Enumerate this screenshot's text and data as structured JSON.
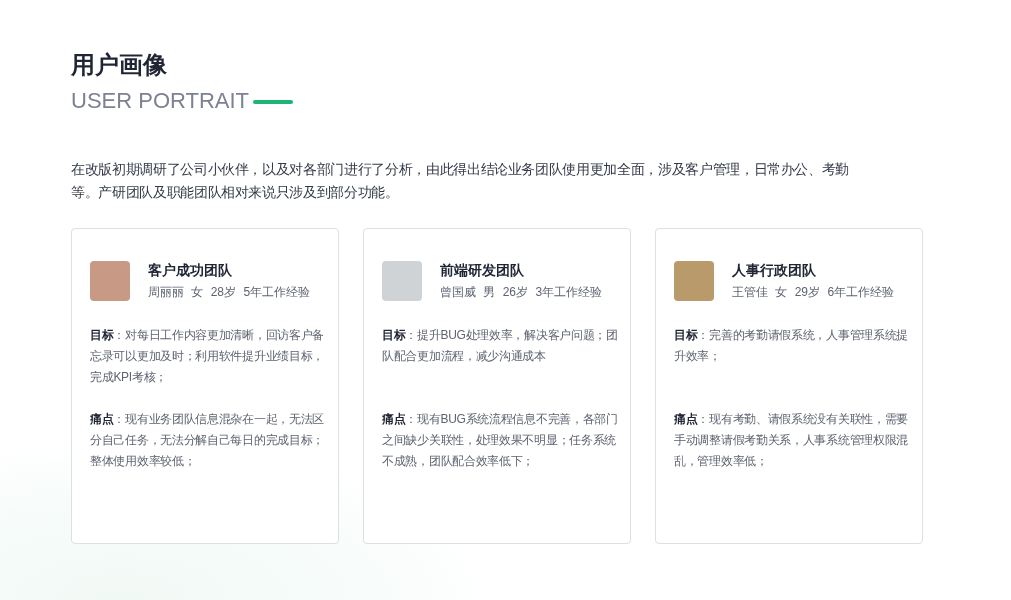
{
  "heading": {
    "title": "用户画像",
    "subtitle": "USER PORTRAIT"
  },
  "intro": "在改版初期调研了公司小伙伴，以及对各部门进行了分析，由此得出结论业务团队使用更加全面，涉及客户管理，日常办公、考勤等。产研团队及职能团队相对来说只涉及到部分功能。",
  "cards": [
    {
      "team": "客户成功团队",
      "name": "周丽丽",
      "gender": "女",
      "age": "28岁",
      "experience": "5年工作经验",
      "goal": "**目标**：对每日工作内容更加清晰，回访客户备忘录可以更加及时；利用软件提升业绩目标，完成KPI考核；",
      "pain": "**痛点**：现有业务团队信息混杂在一起，无法区分自己任务，无法分解自己每日的完成目标；整体使用效率较低；"
    },
    {
      "team": "前端研发团队",
      "name": "曾国威",
      "gender": "男",
      "age": "26岁",
      "experience": "3年工作经验",
      "goal": "**目标**：提升BUG处理效率，解决客户问题；团队配合更加流程，减少沟通成本",
      "pain": "**痛点**：现有BUG系统流程信息不完善，各部门之间缺少关联性，处理效果不明显；任务系统不成熟，团队配合效率低下；"
    },
    {
      "team": "人事行政团队",
      "name": "王管佳",
      "gender": "女",
      "age": "29岁",
      "experience": "6年工作经验",
      "goal": "**目标**：完善的考勤请假系统，人事管理系统提升效率；",
      "pain": "**痛点**：现有考勤、请假系统没有关联性，需要手动调整请假考勤关系，人事系统管理权限混乱，管理效率低；"
    }
  ]
}
